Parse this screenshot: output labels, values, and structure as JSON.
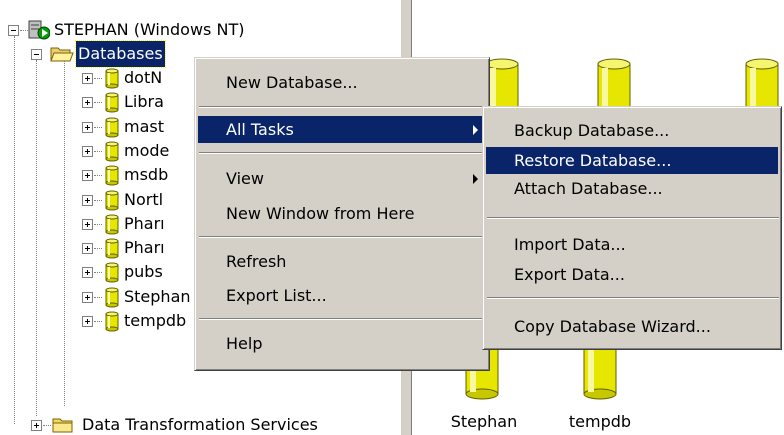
{
  "tree": {
    "server_label": "STEPHAN (Windows NT)",
    "databases_label": "Databases",
    "items": [
      {
        "label": "dotN"
      },
      {
        "label": "Libra"
      },
      {
        "label": "mast"
      },
      {
        "label": "mode"
      },
      {
        "label": "msdb"
      },
      {
        "label": "Nortl"
      },
      {
        "label": "Pharı"
      },
      {
        "label": "Pharı"
      },
      {
        "label": "pubs"
      },
      {
        "label": "Stephan"
      },
      {
        "label": "tempdb"
      }
    ],
    "dts_label": "Data Transformation Services"
  },
  "list_view": {
    "items": [
      {
        "label": ""
      },
      {
        "label": ""
      },
      {
        "label": ""
      },
      {
        "label": "Stephan"
      },
      {
        "label": "tempdb"
      }
    ]
  },
  "context_menu": {
    "items": {
      "new_database": "New Database...",
      "all_tasks": "All Tasks",
      "view": "View",
      "new_window": "New Window from Here",
      "refresh": "Refresh",
      "export_list": "Export List...",
      "help": "Help"
    }
  },
  "submenu": {
    "items": {
      "backup": "Backup Database...",
      "restore": "Restore Database...",
      "attach": "Attach Database...",
      "import": "Import Data...",
      "export": "Export Data...",
      "copy_wizard": "Copy Database Wizard..."
    }
  },
  "colors": {
    "highlight": "#0a246a",
    "menu_face": "#d4d0c8",
    "db_yellow": "#e6e600"
  },
  "icons": {
    "server": "server-running-icon",
    "folder": "folder-icon",
    "database": "database-icon"
  }
}
